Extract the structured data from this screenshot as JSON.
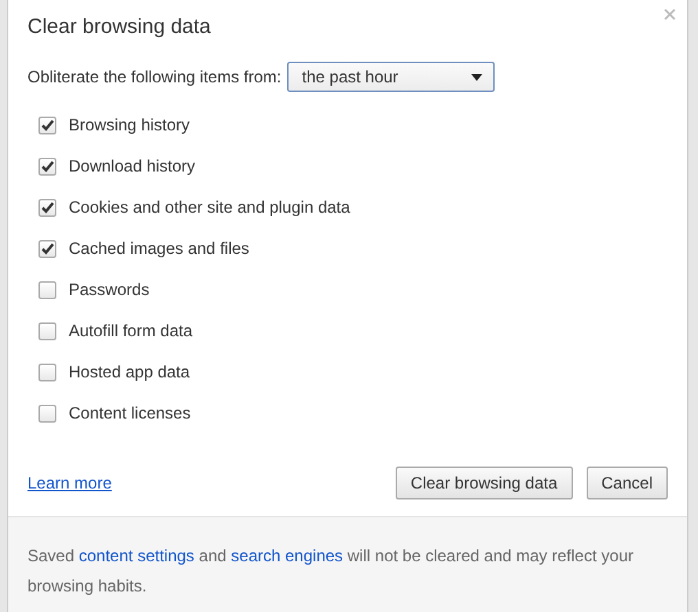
{
  "dialog": {
    "title": "Clear browsing data"
  },
  "range": {
    "label": "Obliterate the following items from:",
    "value": "the past hour"
  },
  "items": [
    {
      "label": "Browsing history",
      "checked": true
    },
    {
      "label": "Download history",
      "checked": true
    },
    {
      "label": "Cookies and other site and plugin data",
      "checked": true
    },
    {
      "label": "Cached images and files",
      "checked": true
    },
    {
      "label": "Passwords",
      "checked": false
    },
    {
      "label": "Autofill form data",
      "checked": false
    },
    {
      "label": "Hosted app data",
      "checked": false
    },
    {
      "label": "Content licenses",
      "checked": false
    }
  ],
  "learn_more": "Learn more",
  "buttons": [
    "Clear browsing data",
    "Cancel"
  ],
  "footer": [
    {
      "kind": "text",
      "text": "Saved"
    },
    {
      "kind": "link",
      "text": "content settings"
    },
    {
      "kind": "text",
      "text": "and"
    },
    {
      "kind": "link",
      "text": "search engines"
    },
    {
      "kind": "text",
      "text": "will not be cleared and may reflect your browsing habits."
    }
  ]
}
